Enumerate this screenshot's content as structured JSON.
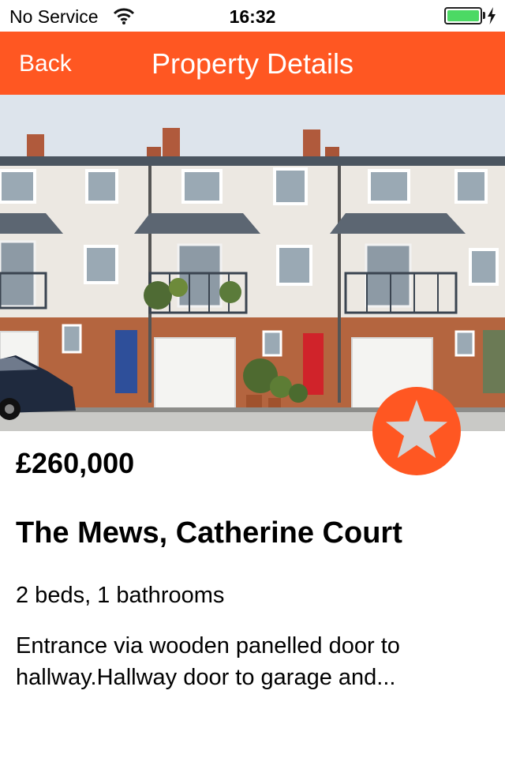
{
  "status_bar": {
    "carrier": "No Service",
    "time": "16:32",
    "battery_color": "#4cd964"
  },
  "nav": {
    "back_label": "Back",
    "title": "Property Details",
    "color": "#ff5722"
  },
  "photo": {
    "subject": "terraced townhouses with garages and balconies"
  },
  "favorite": {
    "icon": "star-icon"
  },
  "listing": {
    "price": "£260,000",
    "address": "The Mews, Catherine Court",
    "rooms": "2 beds, 1 bathrooms",
    "description": "Entrance via wooden panelled door to hallway.Hallway door to garage and..."
  }
}
